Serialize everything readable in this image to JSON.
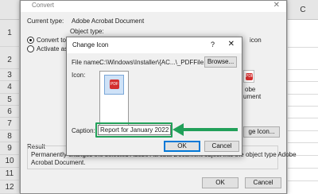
{
  "excel": {
    "column_label": "C",
    "row_numbers": [
      "1",
      "2",
      "3",
      "4",
      "5",
      "6",
      "7",
      "8",
      "9",
      "10",
      "11",
      "12"
    ]
  },
  "convert_dialog": {
    "title": "Convert",
    "close_glyph": "✕",
    "current_type_label": "Current type:",
    "current_type_value": "Adobe Acrobat Document",
    "object_type_label": "Object type:",
    "convert_to_label": "Convert to:",
    "activate_as_label": "Activate as:",
    "display_as_icon_label": "icon",
    "icon_caption_line1": "obe",
    "icon_caption_line2": "ument",
    "pdf_badge": "PDF",
    "change_icon_button": "ge Icon...",
    "result_label": "Result",
    "result_text_line1": "Permanently changes the selected Adobe Acrobat Document object into the object type Adobe",
    "result_text_line2": "Acrobat Document.",
    "ok_label": "OK",
    "cancel_label": "Cancel"
  },
  "change_icon_dialog": {
    "title": "Change Icon",
    "help_glyph": "?",
    "close_glyph": "✕",
    "file_name_label": "File name:",
    "file_name_value": "C:\\Windows\\Installer\\{AC...\\_PDFFile.ico",
    "browse_label": "Browse...",
    "icon_label": "Icon:",
    "pdf_badge": "PDF",
    "caption_label": "Caption:",
    "caption_value": "Report for January 2022",
    "ok_label": "OK",
    "cancel_label": "Cancel"
  },
  "colors": {
    "highlight": "#22a05a",
    "primary_button_border": "#0078d7",
    "pdf_red": "#d32f2f"
  }
}
